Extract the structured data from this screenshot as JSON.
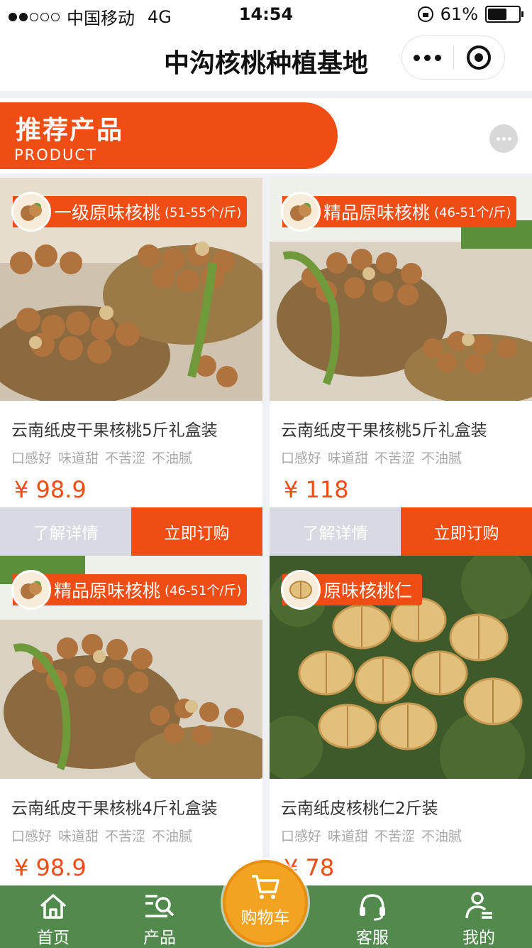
{
  "status_bar": {
    "carrier": "中国移动",
    "network": "4G",
    "time": "14:54",
    "battery": "61%",
    "battery_level": 0.61
  },
  "nav": {
    "title": "中沟核桃种植基地",
    "more_icon": "more-dots-icon",
    "close_icon": "close-target-icon"
  },
  "section": {
    "title": "推荐产品",
    "subtitle": "PRODUCT",
    "accent_color": "#f04d14"
  },
  "products": [
    {
      "badge_name": "一级原味核桃",
      "badge_spec": "(51-55个/斤)",
      "title": "云南纸皮干果核桃5斤礼盒装",
      "tags": [
        "口感好",
        "味道甜",
        "不苦涩",
        "不油腻"
      ],
      "price": "¥ 98.9",
      "detail_label": "了解详情",
      "buy_label": "立即订购"
    },
    {
      "badge_name": "精品原味核桃",
      "badge_spec": "(46-51个/斤)",
      "title": "云南纸皮干果核桃5斤礼盒装",
      "tags": [
        "口感好",
        "味道甜",
        "不苦涩",
        "不油腻"
      ],
      "price": "¥ 118",
      "detail_label": "了解详情",
      "buy_label": "立即订购"
    },
    {
      "badge_name": "精品原味核桃",
      "badge_spec": "(46-51个/斤)",
      "title": "云南纸皮干果核桃4斤礼盒装",
      "tags": [
        "口感好",
        "味道甜",
        "不苦涩",
        "不油腻"
      ],
      "price": "¥ 98.9"
    },
    {
      "badge_name": "原味核桃仁",
      "badge_spec": "",
      "title": "云南纸皮核桃仁2斤装",
      "tags": [
        "口感好",
        "味道甜",
        "不苦涩",
        "不油腻"
      ],
      "price": "¥ 78"
    }
  ],
  "tabbar": {
    "home": "首页",
    "products": "产品",
    "cart": "购物车",
    "service": "客服",
    "mine": "我的",
    "bar_color": "#528a4d",
    "cart_color": "#f3a322"
  }
}
